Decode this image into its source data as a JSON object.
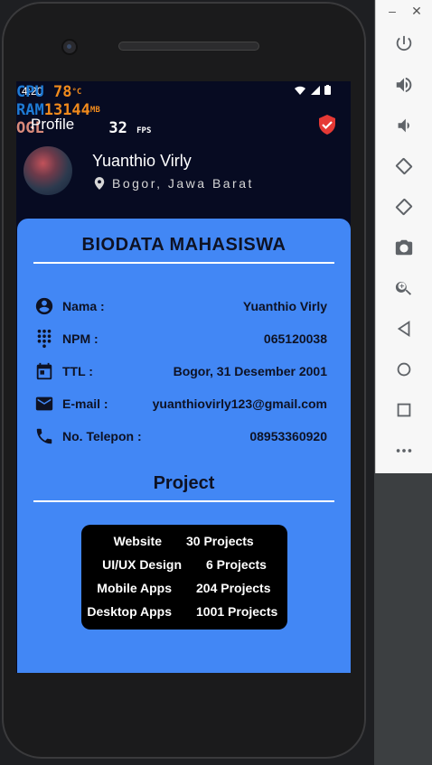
{
  "status_bar": {
    "time": "4:20"
  },
  "overlay": {
    "cpu_label": "CPU",
    "cpu_value": "78",
    "cpu_unit": "°C",
    "ram_label": "RAM",
    "ram_value": "13144",
    "ram_unit": "MB",
    "ogl_label": "OGL",
    "fps_value": "32",
    "fps_unit": "FPS"
  },
  "appbar": {
    "title": "Profile"
  },
  "profile": {
    "name": "Yuanthio Virly",
    "location": "Bogor, Jawa Barat"
  },
  "biodata": {
    "title": "BIODATA MAHASISWA",
    "rows": [
      {
        "label": "Nama :",
        "value": "Yuanthio Virly",
        "icon": "account-circle-icon"
      },
      {
        "label": "NPM :",
        "value": "065120038",
        "icon": "dialpad-icon"
      },
      {
        "label": "TTL :",
        "value": "Bogor, 31 Desember 2001",
        "icon": "calendar-icon"
      },
      {
        "label": "E-mail :",
        "value": "yuanthiovirly123@gmail.com",
        "icon": "email-icon"
      },
      {
        "label": "No. Telepon :",
        "value": "08953360920",
        "icon": "phone-icon"
      }
    ]
  },
  "project": {
    "title": "Project",
    "items": [
      {
        "name": "Website",
        "count": "30 Projects"
      },
      {
        "name": "UI/UX Design",
        "count": "6 Projects"
      },
      {
        "name": "Mobile Apps",
        "count": "204 Projects"
      },
      {
        "name": "Desktop Apps",
        "count": "1001 Projects"
      }
    ]
  },
  "colors": {
    "card": "#4287f5",
    "screen_bg": "#070b22",
    "shield": "#e53935"
  }
}
